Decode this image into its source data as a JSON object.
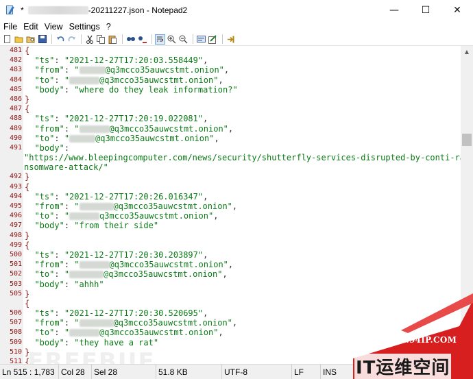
{
  "window": {
    "title_prefix": "*",
    "title_filename_suffix": "-20211227.json",
    "title_separator": " - ",
    "app_name": "Notepad2",
    "controls": {
      "minimize": "—",
      "maximize": "☐",
      "close": "✕"
    }
  },
  "menu": [
    "File",
    "Edit",
    "View",
    "Settings",
    "?"
  ],
  "toolbar": [
    "new-file-icon",
    "open-folder-icon",
    "browse-icon",
    "save-icon",
    "undo-icon",
    "redo-icon",
    "cut-icon",
    "copy-icon",
    "paste-icon",
    "find-icon",
    "replace-icon",
    "word-wrap-icon",
    "zoom-in-icon",
    "zoom-out-icon",
    "schemes-icon",
    "customize-icon",
    "exit-icon"
  ],
  "lines": [
    {
      "n": "481",
      "t": "brace",
      "text": "{"
    },
    {
      "n": "482",
      "t": "kv",
      "key": "\"ts\"",
      "value": "\"2021-12-27T17:20:03.558449\"",
      "comma": ","
    },
    {
      "n": "483",
      "t": "kvr",
      "key": "\"from\"",
      "pre": "\"",
      "rw": 38,
      "post": "@q3mcco35auwcstmt.onion\"",
      "comma": ","
    },
    {
      "n": "484",
      "t": "kvr",
      "key": "\"to\"",
      "pre": "\"",
      "rw": 44,
      "post": "@q3mcco35auwcstmt.onion\"",
      "comma": ","
    },
    {
      "n": "485",
      "t": "kv",
      "key": "\"body\"",
      "value": "\"where do they leak information?\"",
      "comma": ""
    },
    {
      "n": "486",
      "t": "brace",
      "text": "}"
    },
    {
      "n": "487",
      "t": "brace",
      "text": "{"
    },
    {
      "n": "488",
      "t": "kv",
      "key": "\"ts\"",
      "value": "\"2021-12-27T17:20:19.022081\"",
      "comma": ","
    },
    {
      "n": "489",
      "t": "kvr",
      "key": "\"from\"",
      "pre": "\"",
      "rw": 44,
      "post": "@q3mcco35auwcstmt.onion\"",
      "comma": ","
    },
    {
      "n": "490",
      "t": "kvr",
      "key": "\"to\"",
      "pre": "\"",
      "rw": 38,
      "post": "@q3mcco35auwcstmt.onion\"",
      "comma": ","
    },
    {
      "n": "491",
      "t": "key",
      "key": "\"body\"",
      "comma": ":"
    },
    {
      "n": "",
      "t": "wrap",
      "text": "\"https://www.bleepingcomputer.com/news/security/shutterfly-services-disrupted-by-conti-ra"
    },
    {
      "n": "",
      "t": "wrap",
      "text": "nsomware-attack/\""
    },
    {
      "n": "492",
      "t": "brace",
      "text": "}"
    },
    {
      "n": "493",
      "t": "brace",
      "text": "{"
    },
    {
      "n": "494",
      "t": "kv",
      "key": "\"ts\"",
      "value": "\"2021-12-27T17:20:26.016347\"",
      "comma": ","
    },
    {
      "n": "495",
      "t": "kvr",
      "key": "\"from\"",
      "pre": "\"",
      "rw": 50,
      "post": "@q3mcco35auwcstmt.onion\"",
      "comma": ","
    },
    {
      "n": "496",
      "t": "kvr",
      "key": "\"to\"",
      "pre": "\"",
      "rw": 44,
      "post": "q3mcco35auwcstmt.onion\"",
      "comma": ","
    },
    {
      "n": "497",
      "t": "kv",
      "key": "\"body\"",
      "value": "\"from their side\"",
      "comma": ""
    },
    {
      "n": "498",
      "t": "brace",
      "text": "}"
    },
    {
      "n": "499",
      "t": "brace",
      "text": "{"
    },
    {
      "n": "500",
      "t": "kv",
      "key": "\"ts\"",
      "value": "\"2021-12-27T17:20:30.203897\"",
      "comma": ","
    },
    {
      "n": "501",
      "t": "kvr",
      "key": "\"from\"",
      "pre": "\"",
      "rw": 44,
      "post": "@q3mcco35auwcstmt.onion\"",
      "comma": ","
    },
    {
      "n": "502",
      "t": "kvr",
      "key": "\"to\"",
      "pre": "\"",
      "rw": 50,
      "post": "@q3mcco35auwcstmt.onion\"",
      "comma": ","
    },
    {
      "n": "503",
      "t": "kv",
      "key": "\"body\"",
      "value": "\"ahhh\"",
      "comma": ""
    },
    {
      "n": "505",
      "t": "brace",
      "text": "}"
    },
    {
      "n": "",
      "t": "brace",
      "text": "{"
    },
    {
      "n": "506",
      "t": "kv",
      "key": "\"ts\"",
      "value": "\"2021-12-27T17:20:30.520695\"",
      "comma": ","
    },
    {
      "n": "507",
      "t": "kvr",
      "key": "\"from\"",
      "pre": "\"",
      "rw": 50,
      "post": "@q3mcco35auwcstmt.onion\"",
      "comma": ","
    },
    {
      "n": "508",
      "t": "kvr",
      "key": "\"to\"",
      "pre": "\"",
      "rw": 44,
      "post": "@q3mcco35auwcstmt.onion\"",
      "comma": ","
    },
    {
      "n": "509",
      "t": "kv",
      "key": "\"body\"",
      "value": "\"they have a rat\"",
      "comma": ""
    },
    {
      "n": "510",
      "t": "brace",
      "text": "}"
    },
    {
      "n": "511",
      "t": "brace",
      "text": "{"
    }
  ],
  "status": {
    "position": "Ln 515 : 1,783",
    "col": "Col 28",
    "sel": "Sel 28",
    "size": "51.8 KB",
    "encoding": "UTF-8",
    "eol": "LF",
    "mode": "INS"
  },
  "watermarks": {
    "freebuf": "FREEBUF",
    "site_url": "WWW.94IP.COM",
    "site_brand": "IT运维空间"
  }
}
